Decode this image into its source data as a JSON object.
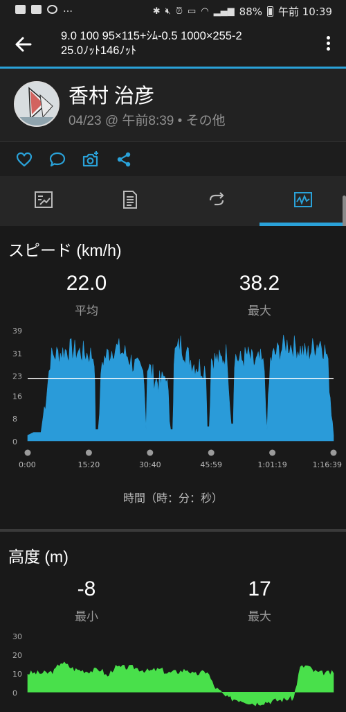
{
  "status_bar": {
    "battery": "88%",
    "time": "午前 10:39",
    "icons": [
      "image-icon",
      "youtube-icon",
      "sync-icon",
      "more-dots-icon",
      "bluetooth-icon",
      "mute-icon",
      "alarm-icon",
      "volte-icon",
      "wifi-icon",
      "signal-icon",
      "battery-icon"
    ]
  },
  "app_bar": {
    "title_line1": "9.0 100 95×115+ｼﾑ-0.5 1000×255-2",
    "title_line2": "25.0ﾉｯﾄ146ﾉｯﾄ"
  },
  "profile": {
    "name": "香村 治彦",
    "meta": "04/23 @ 午前8:39 • その他"
  },
  "social_icons": [
    "heart-icon",
    "comment-icon",
    "add-photo-icon",
    "share-icon"
  ],
  "tabs": [
    "tab-overview",
    "tab-details",
    "tab-laps",
    "tab-charts"
  ],
  "colors": {
    "accent": "#2aa2d9",
    "speed_fill": "#2a9bd9",
    "elevation_fill": "#49e04b"
  },
  "speed": {
    "title": "スピード (km/h)",
    "avg_value": "22.0",
    "avg_label": "平均",
    "max_value": "38.2",
    "max_label": "最大",
    "x_caption": "時間（時：分：秒）"
  },
  "elevation": {
    "title": "高度 (m)",
    "min_value": "-8",
    "min_label": "最小",
    "max_value": "17",
    "max_label": "最大"
  },
  "chart_data": [
    {
      "type": "area",
      "series_color": "#2a9bd9",
      "y_ticks": [
        0,
        8,
        16,
        23,
        31,
        39
      ],
      "ylim": [
        0,
        39
      ],
      "x_ticks": [
        "0:00",
        "15:20",
        "30:40",
        "45:59",
        "1:01:19",
        "1:16:39"
      ],
      "xlim_seconds": [
        0,
        4599
      ],
      "average_line": 22.0,
      "x": [
        0,
        90,
        200,
        300,
        340,
        400,
        600,
        800,
        1000,
        1020,
        1060,
        1120,
        1300,
        1500,
        1650,
        1750,
        1780,
        1800,
        1900,
        2000,
        2080,
        2150,
        2180,
        2200,
        2300,
        2400,
        2500,
        2600,
        2680,
        2700,
        2730,
        2760,
        2900,
        3000,
        3060,
        3090,
        3110,
        3200,
        3300,
        3400,
        3500,
        3560,
        3600,
        3650,
        3700,
        3900,
        4100,
        4200,
        4300,
        4400,
        4500,
        4599
      ],
      "y": [
        2,
        3,
        3,
        20,
        29,
        30,
        32,
        31,
        30,
        4,
        4,
        28,
        33,
        30,
        25,
        24,
        4,
        27,
        22,
        20,
        24,
        4,
        4,
        30,
        34,
        30,
        27,
        26,
        25,
        5,
        5,
        29,
        28,
        31,
        6,
        6,
        30,
        28,
        30,
        27,
        28,
        25,
        4,
        28,
        30,
        34,
        32,
        30,
        33,
        35,
        30,
        2
      ]
    },
    {
      "type": "area",
      "series_color": "#49e04b",
      "y_ticks": [
        0,
        10,
        20,
        30
      ],
      "ylim": [
        -8,
        30
      ],
      "x": [
        0,
        300,
        400,
        500,
        700,
        900,
        1100,
        1200,
        1300,
        1600,
        1800,
        2000,
        2100,
        2300,
        2400,
        2500,
        2700,
        2800,
        3000,
        3200,
        3400,
        3600,
        3800,
        4000,
        4100,
        4200,
        4300,
        4400,
        4599
      ],
      "y": [
        10,
        10,
        11,
        16,
        12,
        11,
        12,
        8,
        13,
        13,
        11,
        12,
        10,
        11,
        12,
        9,
        11,
        3,
        -3,
        -4,
        -6,
        -5,
        -4,
        -3,
        13,
        14,
        11,
        10,
        10
      ]
    }
  ]
}
